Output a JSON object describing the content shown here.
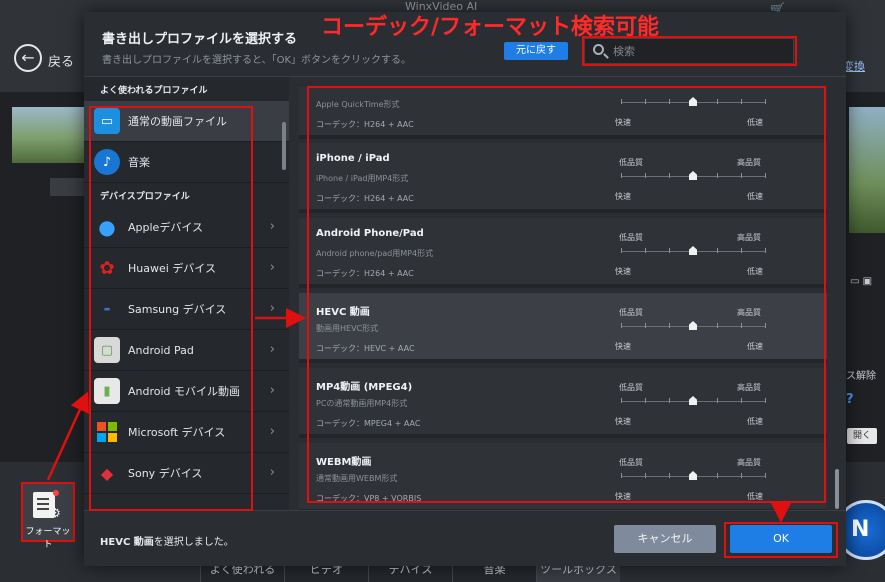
{
  "background": {
    "back_label": "戻る",
    "app_title": "WinxVideo AI",
    "right_link": "変換",
    "right_text": "ス解除",
    "right_q": "?",
    "right_button": "開く",
    "format_button_label": "フォーマット",
    "run_button_label": "N",
    "bottom_tabs": [
      "よく使われる",
      "ビデオ",
      "デバイス",
      "音楽",
      "ツールボックス"
    ]
  },
  "dialog": {
    "title": "書き出しプロファイルを選択する",
    "subtitle": "書き出しプロファイルを選択すると、「OK」ボタンをクリックする。",
    "reset_label": "元に戻す",
    "search_placeholder": "検索",
    "annotation_text": "コーデック/フォーマット検索可能",
    "sidebar": {
      "section_frequent": "よく使われるプロファイル",
      "section_device": "デバイスプロファイル",
      "frequent_items": [
        {
          "label": "通常の動画ファイル",
          "icon": "monitor-icon"
        },
        {
          "label": "音楽",
          "icon": "music-icon"
        }
      ],
      "device_items": [
        {
          "label": "Appleデバイス",
          "icon": "apple-icon"
        },
        {
          "label": "Huawei デバイス",
          "icon": "huawei-icon"
        },
        {
          "label": "Samsung デバイス",
          "icon": "samsung-icon"
        },
        {
          "label": "Android Pad",
          "icon": "tablet-icon"
        },
        {
          "label": "Android モバイル動画",
          "icon": "android-icon"
        },
        {
          "label": "Microsoft デバイス",
          "icon": "microsoft-icon"
        },
        {
          "label": "Sony デバイス",
          "icon": "playstation-icon"
        }
      ]
    },
    "profiles": [
      {
        "name": "",
        "desc": "Apple QuickTime形式",
        "codec": "コーデック：H264 + AAC",
        "quality": 0.5,
        "partial": true
      },
      {
        "name": "iPhone / iPad",
        "desc": "iPhone / iPad用MP4形式",
        "codec": "コーデック：H264 + AAC",
        "quality": 0.5
      },
      {
        "name": "Android Phone/Pad",
        "desc": "Android phone/pad用MP4形式",
        "codec": "コーデック：H264 + AAC",
        "quality": 0.5
      },
      {
        "name": "HEVC 動画",
        "desc": "動画用HEVC形式",
        "codec": "コーデック：HEVC + AAC",
        "quality": 0.5,
        "selected": true
      },
      {
        "name": "MP4動画 (MPEG4)",
        "desc": "PCの通常動画用MP4形式",
        "codec": "コーデック：MPEG4 + AAC",
        "quality": 0.5
      },
      {
        "name": "WEBM動画",
        "desc": "通常動画用WEBM形式",
        "codec": "コーデック：VP8 + VORBIS",
        "quality": 0.5
      }
    ],
    "slider_labels": {
      "low_quality": "低品質",
      "high_quality": "高品質",
      "fast": "快速",
      "slow": "低速"
    },
    "status_prefix": "HEVC 動画",
    "status_suffix": "を選択しました。",
    "cancel_label": "キャンセル",
    "ok_label": "OK"
  }
}
